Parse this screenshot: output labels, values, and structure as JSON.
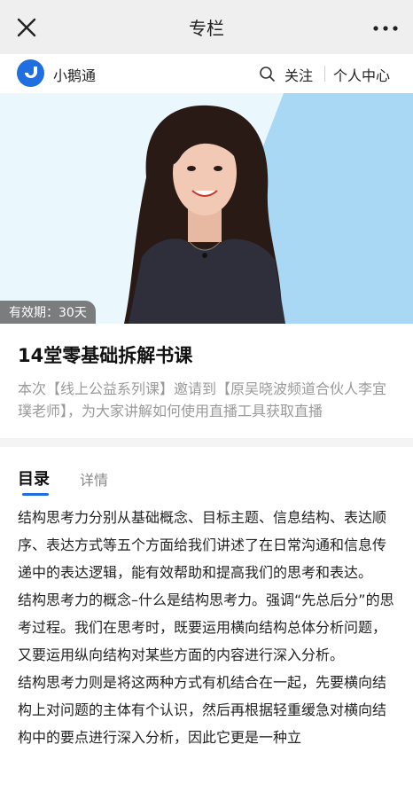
{
  "topbar": {
    "title": "专栏",
    "close_icon": "close-icon",
    "more_icon": "more-icon"
  },
  "brandbar": {
    "brand_name": "小鹅通",
    "follow_label": "关注",
    "personal_center_label": "个人中心"
  },
  "hero": {
    "validity": "有效期：30天"
  },
  "course": {
    "title": "14堂零基础拆解书课",
    "description": "本次【线上公益系列课】邀请到【原吴晓波频道合伙人李宜璞老师】，为大家讲解如何使用直播工具获取直播"
  },
  "tabs": [
    {
      "label": "目录"
    },
    {
      "label": "详情"
    }
  ],
  "content": {
    "paragraphs": [
      "结构思考力分别从基础概念、目标主题、信息结构、表达顺序、表达方式等五个方面给我们讲述了在日常沟通和信息传递中的表达逻辑，能有效帮助和提高我们的思考和表达。",
      "结构思考力的概念–什么是结构思考力。强调“先总后分”的思考过程。我们在思考时，既要运用横向结构总体分析问题，又要运用纵向结构对某些方面的内容进行深入分析。",
      "结构思考力则是将这两种方式有机结合在一起，先要横向结构上对问题的主体有个认识，然后再根据轻重缓急对横向结构中的要点进行深入分析，因此它更是一种立"
    ]
  },
  "colors": {
    "accent": "#1f6fe0",
    "topbar_bg": "#efefef",
    "hero_bg": "#eaf7fd",
    "hero_panel": "#a9d8f5"
  }
}
